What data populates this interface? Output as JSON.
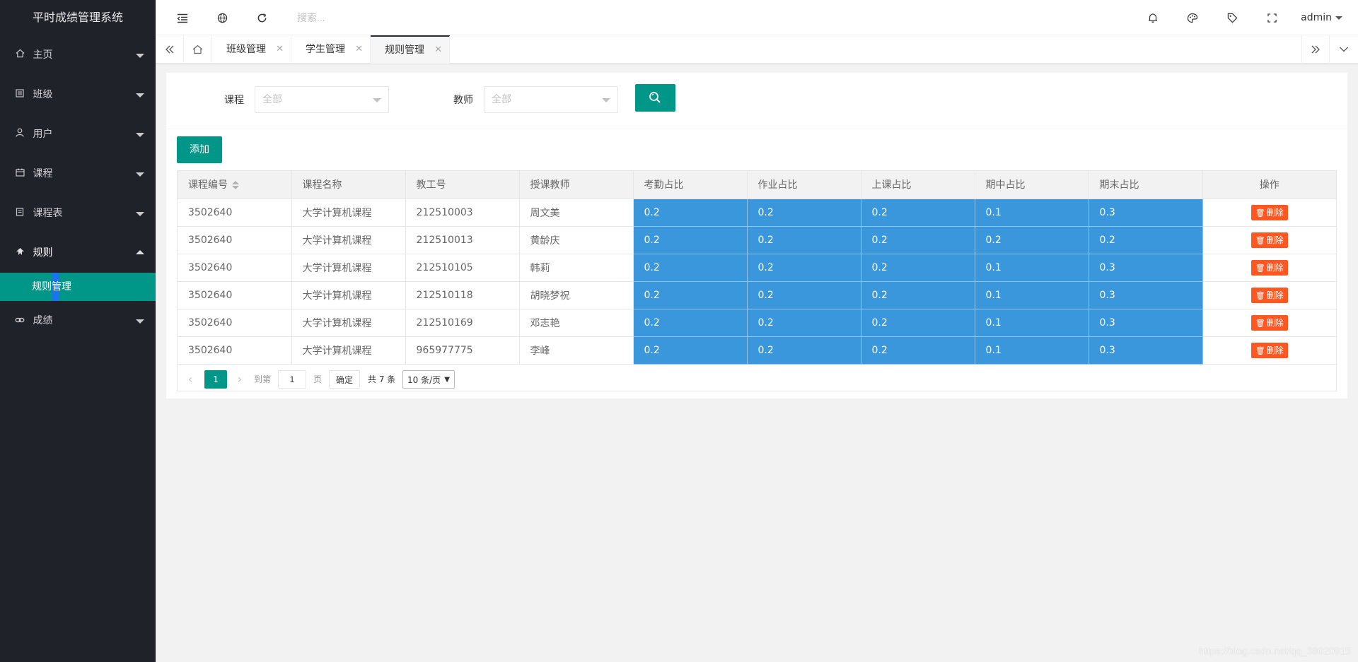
{
  "app": {
    "title": "平时成绩管理系统"
  },
  "sidebar": {
    "items": [
      {
        "label": "主页",
        "icon": "home-icon"
      },
      {
        "label": "班级",
        "icon": "class-icon"
      },
      {
        "label": "用户",
        "icon": "user-icon"
      },
      {
        "label": "课程",
        "icon": "calendar-icon"
      },
      {
        "label": "课程表",
        "icon": "schedule-icon"
      },
      {
        "label": "规则",
        "icon": "rule-icon",
        "expanded": true,
        "children": [
          {
            "label": "规则管理",
            "active": true
          }
        ]
      },
      {
        "label": "成绩",
        "icon": "link-icon"
      }
    ]
  },
  "header": {
    "search_placeholder": "搜索...",
    "user": "admin"
  },
  "tabs": [
    {
      "label": "班级管理"
    },
    {
      "label": "学生管理"
    },
    {
      "label": "规则管理",
      "active": true
    }
  ],
  "filter": {
    "course_label": "课程",
    "course_value": "全部",
    "teacher_label": "教师",
    "teacher_value": "全部"
  },
  "toolbar": {
    "add_label": "添加"
  },
  "table": {
    "columns": [
      "课程编号",
      "课程名称",
      "教工号",
      "授课教师",
      "考勤占比",
      "作业占比",
      "上课占比",
      "期中占比",
      "期末占比",
      "操作"
    ],
    "rows": [
      [
        "3502640",
        "大学计算机课程",
        "212510003",
        "周文美",
        "0.2",
        "0.2",
        "0.2",
        "0.1",
        "0.3"
      ],
      [
        "3502640",
        "大学计算机课程",
        "212510013",
        "黄龄庆",
        "0.2",
        "0.2",
        "0.2",
        "0.2",
        "0.2"
      ],
      [
        "3502640",
        "大学计算机课程",
        "212510105",
        "韩莉",
        "0.2",
        "0.2",
        "0.2",
        "0.1",
        "0.3"
      ],
      [
        "3502640",
        "大学计算机课程",
        "212510118",
        "胡晓梦祝",
        "0.2",
        "0.2",
        "0.2",
        "0.1",
        "0.3"
      ],
      [
        "3502640",
        "大学计算机课程",
        "212510169",
        "邓志艳",
        "0.2",
        "0.2",
        "0.2",
        "0.1",
        "0.3"
      ],
      [
        "3502640",
        "大学计算机课程",
        "965977775",
        "李峰",
        "0.2",
        "0.2",
        "0.2",
        "0.1",
        "0.3"
      ]
    ],
    "delete_label": "删除"
  },
  "pager": {
    "current_page": "1",
    "goto_prefix": "到第",
    "goto_value": "1",
    "goto_suffix": "页",
    "ok_label": "确定",
    "total_label": "共 7 条",
    "page_size": "10 条/页"
  },
  "watermark": "https://blog.csdn.net/qq_38020915",
  "colors": {
    "sidebar_bg": "#20222a",
    "accent": "#009688",
    "danger": "#ff5722",
    "highlight": "#3a97db"
  }
}
